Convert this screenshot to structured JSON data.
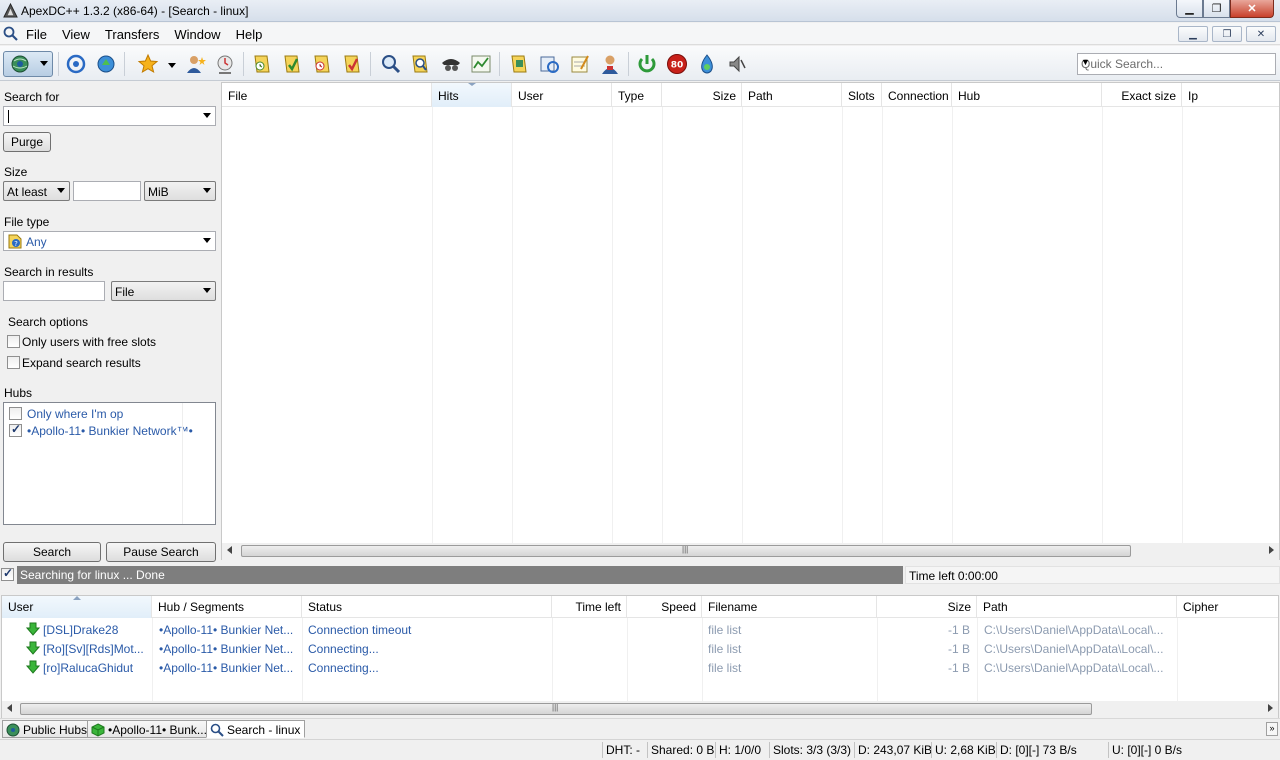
{
  "window": {
    "title": "ApexDC++ 1.3.2 (x86-64) - [Search - linux]",
    "controls": [
      "minimize",
      "maximize",
      "close"
    ]
  },
  "menu": {
    "items": [
      {
        "label": "File"
      },
      {
        "label": "View"
      },
      {
        "label": "Transfers"
      },
      {
        "label": "Window"
      },
      {
        "label": "Help"
      }
    ]
  },
  "toolbar": {
    "icons": [
      "connect-icon",
      "reconnect-icon",
      "follow-redirect-icon",
      "favorites-icon",
      "favorite-users-icon",
      "recent-hubs-icon",
      "queue-icon",
      "finished-downloads-icon",
      "upload-queue-icon",
      "finished-uploads-icon",
      "search-icon",
      "adl-search-icon",
      "search-spy-icon",
      "network-stats-icon",
      "open-file-list-icon",
      "refresh-share-icon",
      "notepad-icon",
      "settings-icon",
      "away-icon",
      "limiter-icon",
      "disable-sounds-icon",
      "shutdown-icon"
    ],
    "limiter_value": "80",
    "quick_search_placeholder": "Quick Search..."
  },
  "search_panel": {
    "search_for_label": "Search for",
    "search_for_value": "",
    "purge_label": "Purge",
    "size_label": "Size",
    "size_mode": "At least",
    "size_value": "",
    "size_unit": "MiB",
    "file_type_label": "File type",
    "file_type_value": "Any",
    "search_in_results_label": "Search in results",
    "search_in_results_value": "",
    "search_in_results_field": "File",
    "search_options_label": "Search options",
    "option_free_slots": "Only users with free slots",
    "option_expand": "Expand search results",
    "hubs_label": "Hubs",
    "hubs": [
      {
        "name": "Only where I'm op",
        "checked": false
      },
      {
        "name": "•Apollo-11• Bunkier Network™•",
        "checked": true
      }
    ],
    "search_button": "Search",
    "pause_button": "Pause Search"
  },
  "results": {
    "columns": [
      "File",
      "Hits",
      "User",
      "Type",
      "Size",
      "Path",
      "Slots",
      "Connection",
      "Hub",
      "Exact size",
      "Ip"
    ],
    "rows": []
  },
  "search_status": {
    "text": "Searching for linux ... Done",
    "time_left": "Time left 0:00:00",
    "checked": true
  },
  "transfers": {
    "columns": [
      "User",
      "Hub / Segments",
      "Status",
      "Time left",
      "Speed",
      "Filename",
      "Size",
      "Path",
      "Cipher"
    ],
    "rows": [
      {
        "user": "[DSL]Drake28",
        "hub": "•Apollo-11• Bunkier Net...",
        "status": "Connection timeout",
        "time_left": "",
        "speed": "",
        "filename": "file list",
        "size": "-1 B",
        "path": "C:\\Users\\Daniel\\AppData\\Local\\...",
        "cipher": ""
      },
      {
        "user": "[Ro][Sv][Rds]Mot...",
        "hub": "•Apollo-11• Bunkier Net...",
        "status": "Connecting...",
        "time_left": "",
        "speed": "",
        "filename": "file list",
        "size": "-1 B",
        "path": "C:\\Users\\Daniel\\AppData\\Local\\...",
        "cipher": ""
      },
      {
        "user": "[ro]RalucaGhidut",
        "hub": "•Apollo-11• Bunkier Net...",
        "status": "Connecting...",
        "time_left": "",
        "speed": "",
        "filename": "file list",
        "size": "-1 B",
        "path": "C:\\Users\\Daniel\\AppData\\Local\\...",
        "cipher": ""
      }
    ]
  },
  "tabs": [
    {
      "label": "Public Hubs"
    },
    {
      "label": "•Apollo-11• Bunk..."
    },
    {
      "label": "Search - linux"
    }
  ],
  "statusbar": {
    "dht": "DHT: -",
    "shared": "Shared: 0 B",
    "hubs": "H: 1/0/0",
    "slots": "Slots: 3/3 (3/3)",
    "downloaded": "D: 243,07 KiB",
    "uploaded": "U: 2,68 KiB",
    "down_speed": "D: [0][-] 73 B/s",
    "up_speed": "U: [0][-] 0 B/s"
  }
}
